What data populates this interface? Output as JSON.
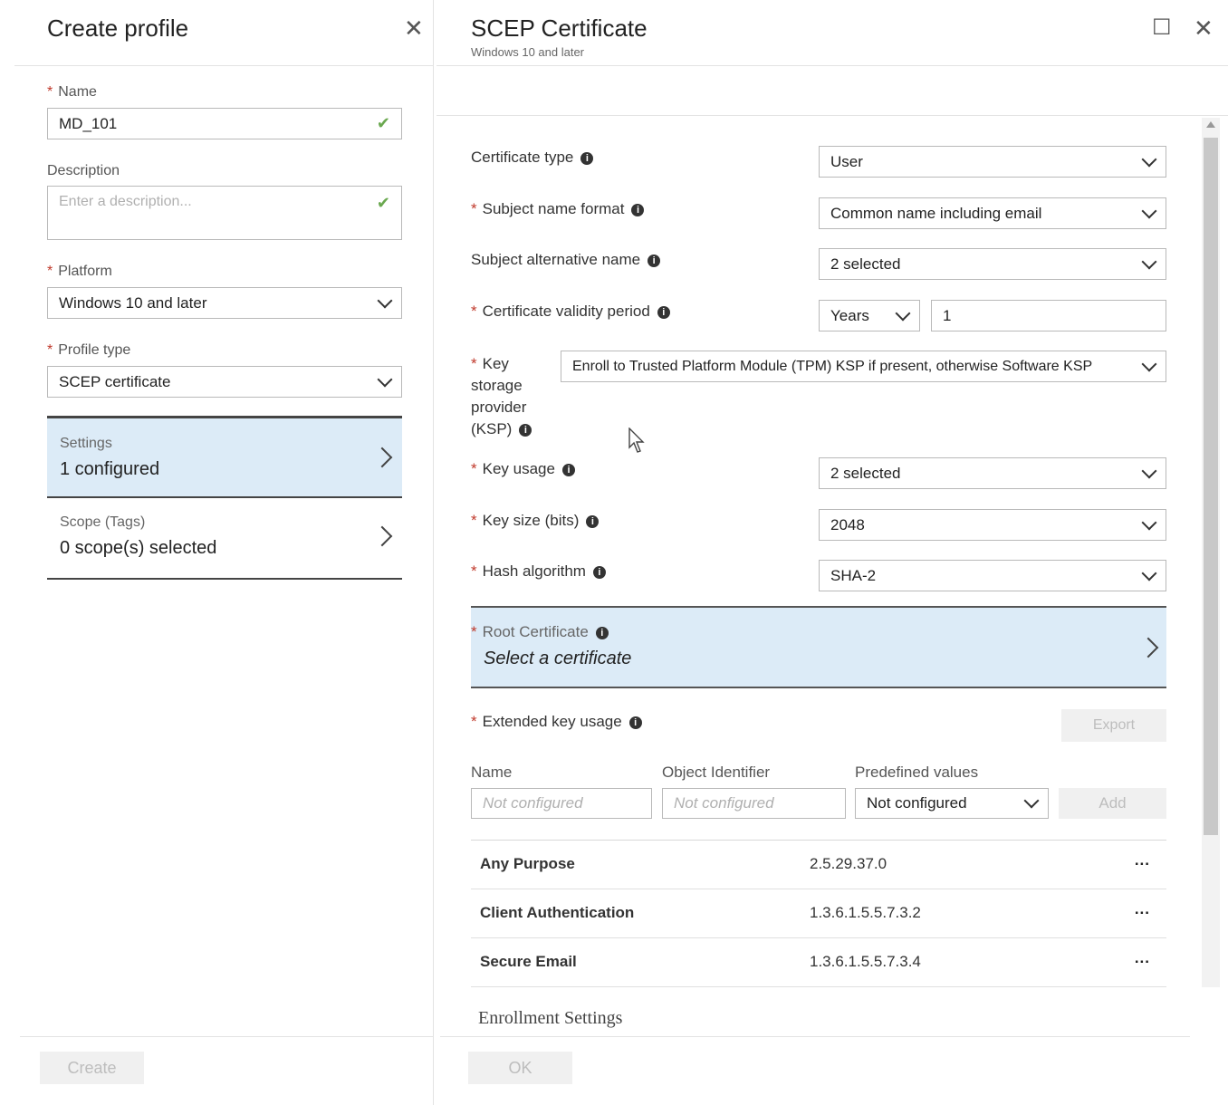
{
  "create_profile": {
    "title": "Create profile",
    "close_glyph": "✕",
    "name": {
      "label": "Name",
      "value": "MD_101"
    },
    "description": {
      "label": "Description",
      "placeholder": "Enter a description..."
    },
    "platform": {
      "label": "Platform",
      "value": "Windows 10 and later"
    },
    "profile_type": {
      "label": "Profile type",
      "value": "SCEP certificate"
    },
    "settings": {
      "label": "Settings",
      "value": "1 configured"
    },
    "scope": {
      "label": "Scope (Tags)",
      "value": "0 scope(s) selected"
    },
    "create_button": "Create"
  },
  "scep": {
    "title": "SCEP Certificate",
    "subtitle": "Windows 10 and later",
    "maximize_glyph": "☐",
    "close_glyph": "✕",
    "certificate_type": {
      "label": "Certificate type",
      "value": "User"
    },
    "subject_name_format": {
      "label": "Subject name format",
      "value": "Common name including email"
    },
    "subject_alt_name": {
      "label": "Subject alternative name",
      "value": "2 selected"
    },
    "validity_period": {
      "label": "Certificate validity period",
      "unit": "Years",
      "value": "1"
    },
    "ksp": {
      "label_lines": [
        "Key",
        "storage",
        "provider",
        "(KSP)"
      ],
      "value": "Enroll to Trusted Platform Module (TPM) KSP if present, otherwise Software KSP"
    },
    "key_usage": {
      "label": "Key usage",
      "value": "2 selected"
    },
    "key_size": {
      "label": "Key size (bits)",
      "value": "2048"
    },
    "hash_algorithm": {
      "label": "Hash algorithm",
      "value": "SHA-2"
    },
    "root_certificate": {
      "label": "Root Certificate",
      "value": "Select a certificate"
    },
    "eku": {
      "label": "Extended key usage",
      "export_button": "Export",
      "col_name": "Name",
      "col_oid": "Object Identifier",
      "col_predefined": "Predefined values",
      "name_placeholder": "Not configured",
      "oid_placeholder": "Not configured",
      "predefined_value": "Not configured",
      "add_button": "Add",
      "rows": [
        {
          "name": "Any Purpose",
          "oid": "2.5.29.37.0"
        },
        {
          "name": "Client Authentication",
          "oid": "1.3.6.1.5.5.7.3.2"
        },
        {
          "name": "Secure Email",
          "oid": "1.3.6.1.5.5.7.3.4"
        }
      ],
      "more_glyph": "..."
    },
    "enrollment_heading": "Enrollment Settings",
    "ok_button": "OK"
  },
  "colors": {
    "selected_card": "#dcebf7",
    "required": "#c0392b",
    "check": "#6aa84f"
  }
}
